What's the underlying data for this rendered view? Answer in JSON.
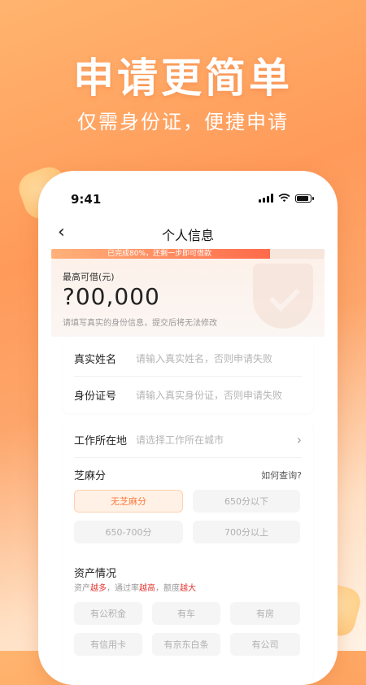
{
  "hero": {
    "title": "申请更简单",
    "subtitle": "仅需身份证，便捷申请"
  },
  "status_bar": {
    "time": "9:41"
  },
  "nav": {
    "back_icon": "‹",
    "title": "个人信息"
  },
  "progress": {
    "text": "已完成80%，还剩一步即可借款",
    "percent": 80,
    "color_start": "#ffb27a",
    "color_end": "#ff6a4a"
  },
  "amount": {
    "label": "最高可借(元)",
    "value": "?00,000",
    "tip": "请填写真实的身份信息，提交后将无法修改"
  },
  "identity": {
    "name_label": "真实姓名",
    "name_placeholder": "请输入真实姓名，否则申请失败",
    "id_label": "身份证号",
    "id_placeholder": "请输入真实身份证，否则申请失败"
  },
  "work": {
    "label": "工作所在地",
    "placeholder": "请选择工作所在城市",
    "chevron": "›"
  },
  "sesame": {
    "title": "芝麻分",
    "help": "如何查询?",
    "options": [
      "无芝麻分",
      "650分以下",
      "650-700分",
      "700分以上"
    ],
    "selected": "无芝麻分"
  },
  "assets": {
    "title": "资产情况",
    "note_parts": [
      "资产",
      "越多",
      "，通过率",
      "越高",
      "，额度",
      "越大"
    ],
    "options": [
      "有公积金",
      "有车",
      "有房",
      "有信用卡",
      "有京东白条",
      "有公司"
    ]
  },
  "colors": {
    "accent": "#ff7a3c",
    "highlight": "#e53935"
  }
}
